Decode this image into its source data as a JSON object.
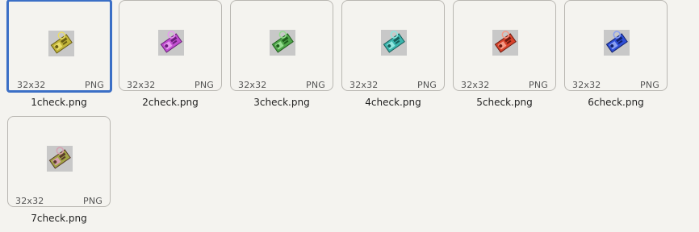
{
  "files": [
    {
      "name": "1check.png",
      "size": "32x32",
      "format": "PNG",
      "selected": true,
      "color": "#c2b53a",
      "dark": "#6a5e12",
      "accent": "#e8dc6a"
    },
    {
      "name": "2check.png",
      "size": "32x32",
      "format": "PNG",
      "selected": false,
      "color": "#c14fd0",
      "dark": "#6b1f7a",
      "accent": "#e79af0"
    },
    {
      "name": "3check.png",
      "size": "32x32",
      "format": "PNG",
      "selected": false,
      "color": "#4fa54a",
      "dark": "#1f5e1c",
      "accent": "#96dc8f"
    },
    {
      "name": "4check.png",
      "size": "32x32",
      "format": "PNG",
      "selected": false,
      "color": "#3bb5ad",
      "dark": "#165f5a",
      "accent": "#8fe6df"
    },
    {
      "name": "5check.png",
      "size": "32x32",
      "format": "PNG",
      "selected": false,
      "color": "#d8442c",
      "dark": "#6e1a10",
      "accent": "#f59a86"
    },
    {
      "name": "6check.png",
      "size": "32x32",
      "format": "PNG",
      "selected": false,
      "color": "#2f4fd6",
      "dark": "#12226e",
      "accent": "#8aa0f2"
    },
    {
      "name": "7check.png",
      "size": "32x32",
      "format": "PNG",
      "selected": false,
      "color": "#a3a646",
      "dark": "#5a3a2a",
      "accent": "#d79fb0"
    }
  ]
}
